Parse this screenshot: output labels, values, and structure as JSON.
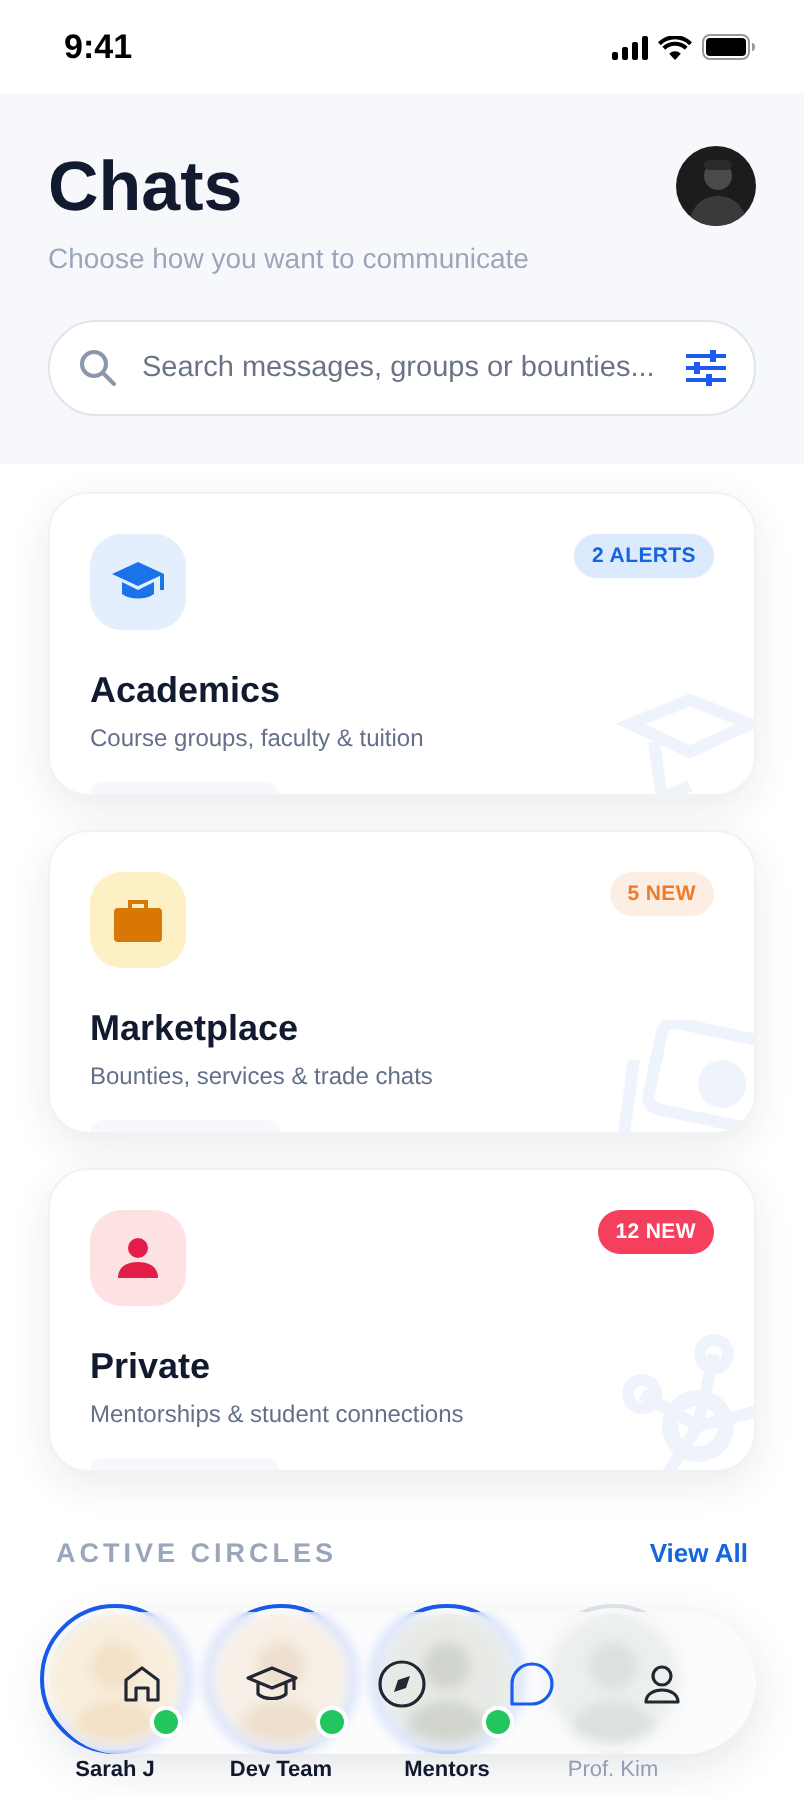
{
  "status_bar": {
    "time": "9:41"
  },
  "header": {
    "title": "Chats",
    "subtitle": "Choose how you want to communicate"
  },
  "search": {
    "placeholder": "Search messages, groups or bounties..."
  },
  "categories": [
    {
      "kind": "academics",
      "title": "Academics",
      "description": "Course groups, faculty & tuition",
      "badge": "2 ALERTS"
    },
    {
      "kind": "marketplace",
      "title": "Marketplace",
      "description": "Bounties, services & trade chats",
      "badge": "5 NEW"
    },
    {
      "kind": "private",
      "title": "Private",
      "description": "Mentorships & student connections",
      "badge": "12 NEW"
    }
  ],
  "active_circles": {
    "heading": "ACTIVE CIRCLES",
    "link": "View All",
    "items": [
      {
        "name": "Sarah J",
        "online": true
      },
      {
        "name": "Dev Team",
        "online": true
      },
      {
        "name": "Mentors",
        "online": true
      },
      {
        "name": "Prof. Kim",
        "online": false
      }
    ]
  },
  "nav": [
    {
      "kind": "home",
      "selected": false
    },
    {
      "kind": "courses",
      "selected": false
    },
    {
      "kind": "explore",
      "selected": false
    },
    {
      "kind": "chats",
      "selected": true
    },
    {
      "kind": "profile",
      "selected": false
    }
  ]
}
